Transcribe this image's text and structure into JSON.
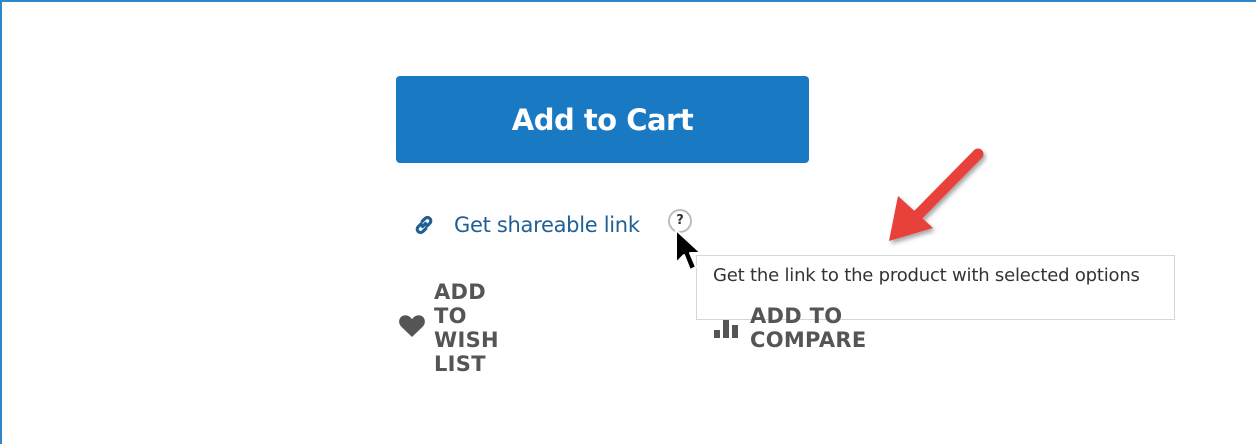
{
  "product": {
    "add_to_cart_label": "Add to Cart",
    "share_link_label": "Get shareable link",
    "help_icon_glyph": "?",
    "tooltip_text": "Get the link to the product with selected options",
    "wish_list_label": "ADD TO WISH LIST",
    "compare_label": "ADD TO COMPARE"
  },
  "icons": {
    "share": "link-icon",
    "help": "question-circle-icon",
    "wish": "heart-icon",
    "compare": "bar-chart-icon",
    "cursor": "mouse-pointer-icon",
    "annotation": "red-arrow-icon"
  },
  "colors": {
    "accent": "#1979c3",
    "link": "#1f5f96",
    "frame_border": "#2f86c8",
    "annotation_arrow": "#e8413a"
  }
}
